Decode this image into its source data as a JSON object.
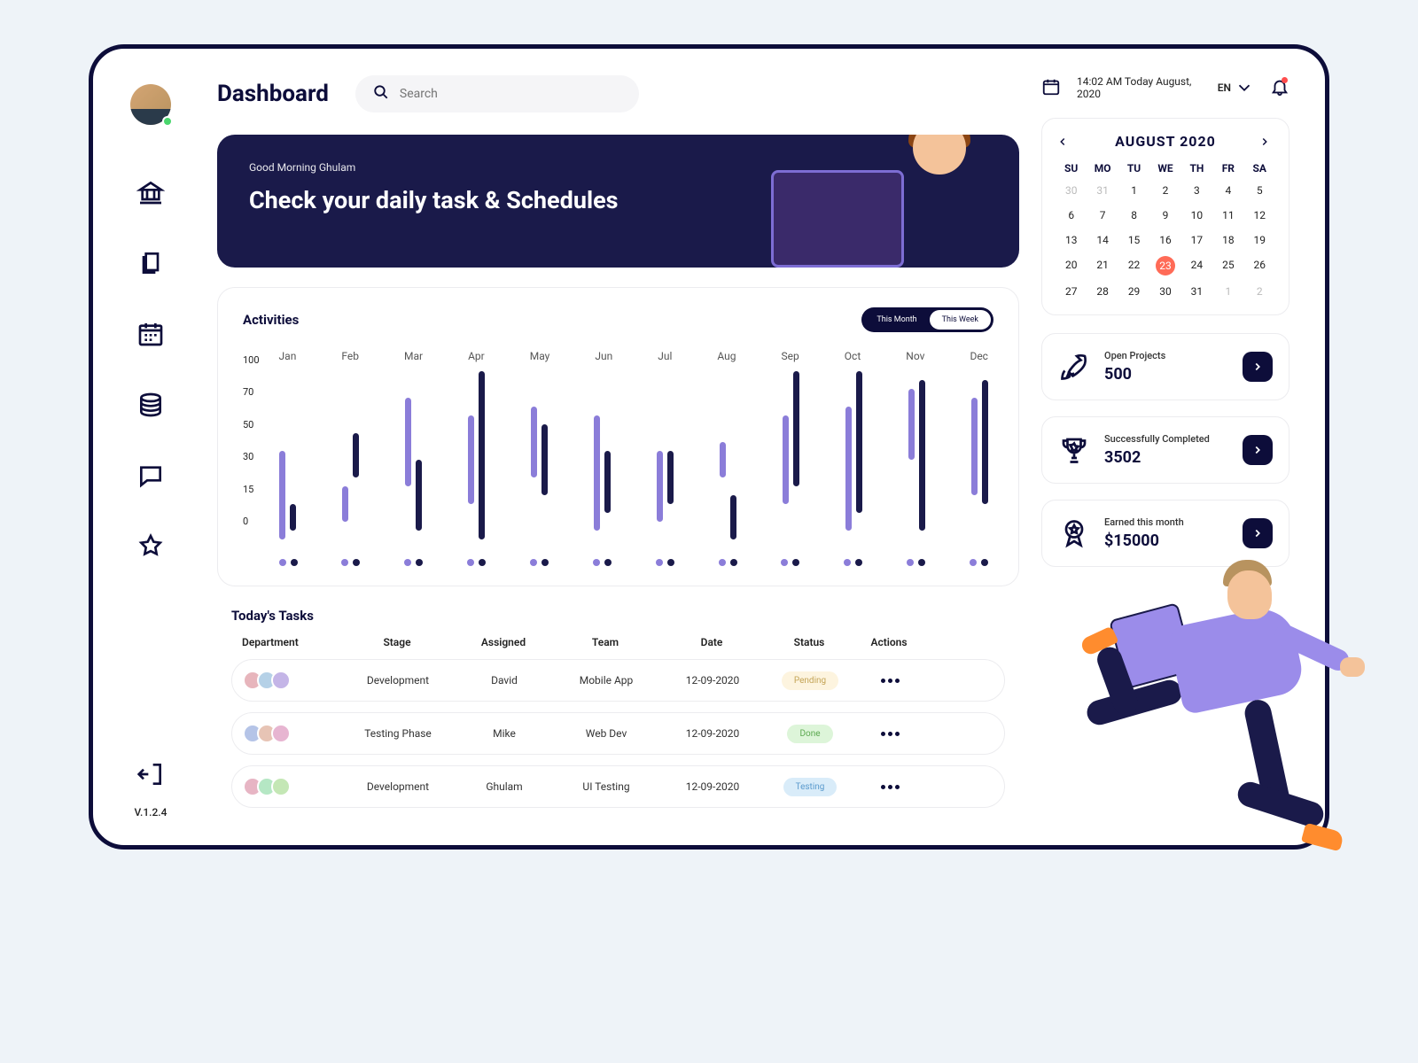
{
  "page_title": "Dashboard",
  "search_placeholder": "Search",
  "datetime_text": "14:02 AM Today August, 2020",
  "lang": "EN",
  "version": "V.1.2.4",
  "hero": {
    "greeting": "Good Morning Ghulam",
    "title": "Check your daily task & Schedules"
  },
  "activities": {
    "title": "Activities",
    "toggle_month": "This Month",
    "toggle_week": "This Week",
    "active_toggle": "week"
  },
  "chart_data": {
    "type": "bar",
    "categories": [
      "Jan",
      "Feb",
      "Mar",
      "Apr",
      "May",
      "Jun",
      "Jul",
      "Aug",
      "Sep",
      "Oct",
      "Nov",
      "Dec"
    ],
    "y_ticks": [
      100,
      70,
      50,
      30,
      15,
      0
    ],
    "ylim": [
      0,
      100
    ],
    "series": [
      {
        "name": "purple",
        "values": [
          [
            5,
            55
          ],
          [
            15,
            35
          ],
          [
            35,
            85
          ],
          [
            25,
            75
          ],
          [
            40,
            80
          ],
          [
            10,
            75
          ],
          [
            15,
            55
          ],
          [
            40,
            60
          ],
          [
            25,
            75
          ],
          [
            10,
            80
          ],
          [
            50,
            90
          ],
          [
            30,
            85
          ]
        ]
      },
      {
        "name": "dark",
        "values": [
          [
            10,
            25
          ],
          [
            40,
            65
          ],
          [
            10,
            50
          ],
          [
            5,
            100
          ],
          [
            30,
            70
          ],
          [
            20,
            55
          ],
          [
            25,
            55
          ],
          [
            5,
            30
          ],
          [
            35,
            100
          ],
          [
            20,
            100
          ],
          [
            10,
            95
          ],
          [
            25,
            95
          ]
        ]
      }
    ]
  },
  "tasks": {
    "title": "Today's Tasks",
    "columns": {
      "dept": "Department",
      "stage": "Stage",
      "assigned": "Assigned",
      "team": "Team",
      "date": "Date",
      "status": "Status",
      "actions": "Actions"
    },
    "rows": [
      {
        "stage": "Development",
        "assigned": "David",
        "team": "Mobile App",
        "date": "12-09-2020",
        "status": "Pending",
        "status_class": "pending",
        "avatars": [
          "#e7b5bc",
          "#b5d1e7",
          "#c4b5e7"
        ]
      },
      {
        "stage": "Testing Phase",
        "assigned": "Mike",
        "team": "Web Dev",
        "date": "12-09-2020",
        "status": "Done",
        "status_class": "done",
        "avatars": [
          "#b5c4e7",
          "#e7c4b5",
          "#e7b5d1"
        ]
      },
      {
        "stage": "Development",
        "assigned": "Ghulam",
        "team": "UI Testing",
        "date": "12-09-2020",
        "status": "Testing",
        "status_class": "testing",
        "avatars": [
          "#e7b5c4",
          "#b5e7c4",
          "#c4e7b5"
        ]
      }
    ]
  },
  "calendar": {
    "title": "AUGUST 2020",
    "dow": [
      "SU",
      "MO",
      "TU",
      "WE",
      "TH",
      "FR",
      "SA"
    ],
    "weeks": [
      [
        {
          "d": 30,
          "muted": true
        },
        {
          "d": 31,
          "muted": true
        },
        {
          "d": 1
        },
        {
          "d": 2
        },
        {
          "d": 3
        },
        {
          "d": 4
        },
        {
          "d": 5
        }
      ],
      [
        {
          "d": 6
        },
        {
          "d": 7
        },
        {
          "d": 8
        },
        {
          "d": 9
        },
        {
          "d": 10
        },
        {
          "d": 11
        },
        {
          "d": 12
        }
      ],
      [
        {
          "d": 13
        },
        {
          "d": 14
        },
        {
          "d": 15
        },
        {
          "d": 16
        },
        {
          "d": 17
        },
        {
          "d": 18
        },
        {
          "d": 19
        }
      ],
      [
        {
          "d": 20
        },
        {
          "d": 21
        },
        {
          "d": 22
        },
        {
          "d": 23,
          "today": true
        },
        {
          "d": 24
        },
        {
          "d": 25
        },
        {
          "d": 26
        }
      ],
      [
        {
          "d": 27
        },
        {
          "d": 28
        },
        {
          "d": 29
        },
        {
          "d": 30
        },
        {
          "d": 31
        },
        {
          "d": 1,
          "muted": true
        },
        {
          "d": 2,
          "muted": true
        }
      ]
    ]
  },
  "stats": [
    {
      "icon": "rocket",
      "label": "Open Projects",
      "value": "500"
    },
    {
      "icon": "trophy",
      "label": "Successfully Completed",
      "value": "3502"
    },
    {
      "icon": "badge",
      "label": "Earned this month",
      "value": "$15000"
    }
  ]
}
